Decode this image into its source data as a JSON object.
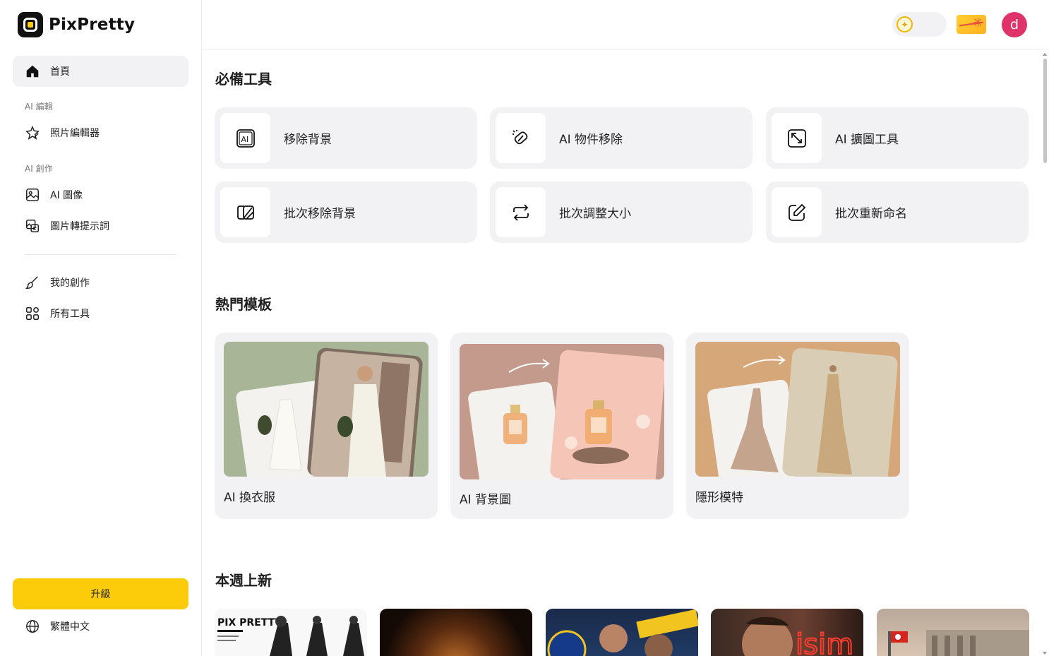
{
  "brand": {
    "name": "PixPretty"
  },
  "sidebar": {
    "home": "首頁",
    "section_edit": "AI 編輯",
    "photo_editor": "照片編輯器",
    "section_create": "AI 創作",
    "ai_image": "AI 圖像",
    "image_to_prompt": "圖片轉提示詞",
    "my_creations": "我的創作",
    "all_tools": "所有工具",
    "upgrade": "升級",
    "language": "繁體中文"
  },
  "topbar": {
    "avatar_letter": "d",
    "credits_icon": "sparkle-coin-icon",
    "ticket_icon": "ticket-icon"
  },
  "essentials": {
    "title": "必備工具",
    "tools": [
      {
        "label": "移除背景",
        "icon": "ai-box-icon"
      },
      {
        "label": "AI 物件移除",
        "icon": "eraser-icon"
      },
      {
        "label": "AI 擴圖工具",
        "icon": "expand-icon"
      },
      {
        "label": "批次移除背景",
        "icon": "batch-remove-icon"
      },
      {
        "label": "批次調整大小",
        "icon": "repeat-icon"
      },
      {
        "label": "批次重新命名",
        "icon": "edit-icon"
      }
    ]
  },
  "templates": {
    "title": "熱門模板",
    "items": [
      {
        "label": "AI 換衣服"
      },
      {
        "label": "AI 背景圖"
      },
      {
        "label": "隱形模特"
      }
    ]
  },
  "new_this_week": {
    "title": "本週上新",
    "thumb1_logo": "PIX PRETTY"
  },
  "colors": {
    "accent": "#fccc0b",
    "avatar": "#e0336a",
    "card_bg": "#f2f2f4"
  }
}
